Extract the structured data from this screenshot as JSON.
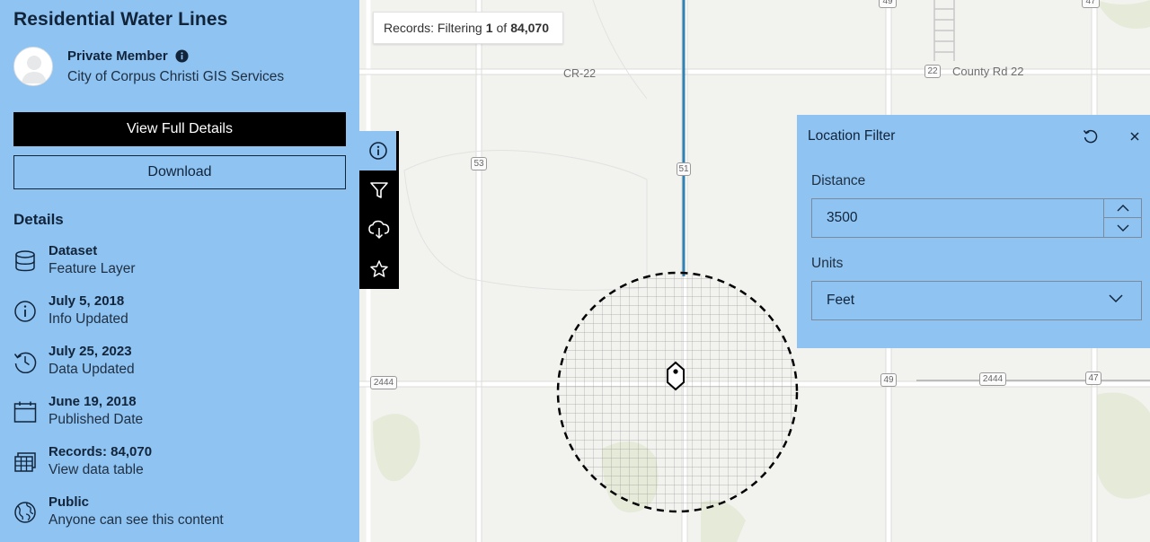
{
  "panel": {
    "title": "Residential Water Lines",
    "owner": {
      "name": "Private Member",
      "org": "City of Corpus Christi GIS Services"
    },
    "view_details_label": "View Full Details",
    "download_label": "Download",
    "details_heading": "Details",
    "details": [
      {
        "icon": "database-icon",
        "primary": "Dataset",
        "secondary": "Feature Layer"
      },
      {
        "icon": "info-icon",
        "primary": "July 5, 2018",
        "secondary": "Info Updated"
      },
      {
        "icon": "history-icon",
        "primary": "July 25, 2023",
        "secondary": "Data Updated"
      },
      {
        "icon": "calendar-icon",
        "primary": "June 19, 2018",
        "secondary": "Published Date"
      },
      {
        "icon": "table-icon",
        "primary": "Records: 84,070",
        "secondary": "View data table"
      },
      {
        "icon": "globe-icon",
        "primary": "Public",
        "secondary": "Anyone can see this content"
      }
    ]
  },
  "records": {
    "prefix": "Records: Filtering",
    "filtered": "1",
    "of_label": "of",
    "total": "84,070"
  },
  "toolbar": [
    {
      "icon": "info-icon",
      "active": true
    },
    {
      "icon": "filter-icon",
      "active": false
    },
    {
      "icon": "download-icon",
      "active": false
    },
    {
      "icon": "star-icon",
      "active": false
    }
  ],
  "map": {
    "road_labels": [
      "CR-22",
      "County Rd 22"
    ],
    "shields": [
      "49",
      "47",
      "22",
      "53",
      "51",
      "2444",
      "49",
      "2444",
      "47"
    ]
  },
  "filter": {
    "title": "Location Filter",
    "distance_label": "Distance",
    "distance_value": "3500",
    "units_label": "Units",
    "units_value": "Feet"
  },
  "colors": {
    "panel": "#8ec3f2",
    "water_line": "#2f82b3",
    "text_dark": "#12243a"
  }
}
